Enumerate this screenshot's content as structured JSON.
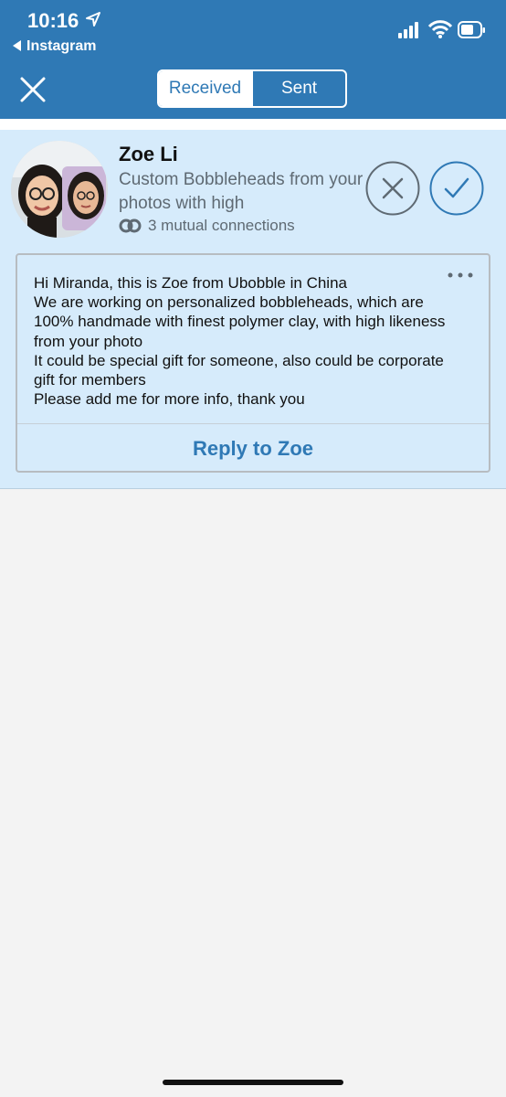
{
  "status_bar": {
    "time": "10:16",
    "back_app": "Instagram",
    "icons": [
      "cellular-signal-icon",
      "wifi-icon",
      "battery-icon"
    ]
  },
  "header": {
    "tabs": [
      {
        "label": "Received",
        "active": true
      },
      {
        "label": "Sent",
        "active": false
      }
    ],
    "close_icon": "close-icon"
  },
  "invitation": {
    "name": "Zoe Li",
    "headline": "Custom Bobbleheads from your photos with high",
    "mutual_connections": "3 mutual connections",
    "message": "Hi Miranda, this is Zoe from Ubobble in China\nWe are working on personalized bobbleheads, which are 100% handmade with finest polymer clay, with high likeness from your photo\nIt could be special gift for someone, also could be corporate gift for members\nPlease add me for more info, thank you",
    "reply_label": "Reply to Zoe"
  },
  "colors": {
    "header": "#2f79b5",
    "card_background": "#d6ebfb",
    "page_background": "#f3f3f3",
    "accent": "#2f79b5"
  }
}
